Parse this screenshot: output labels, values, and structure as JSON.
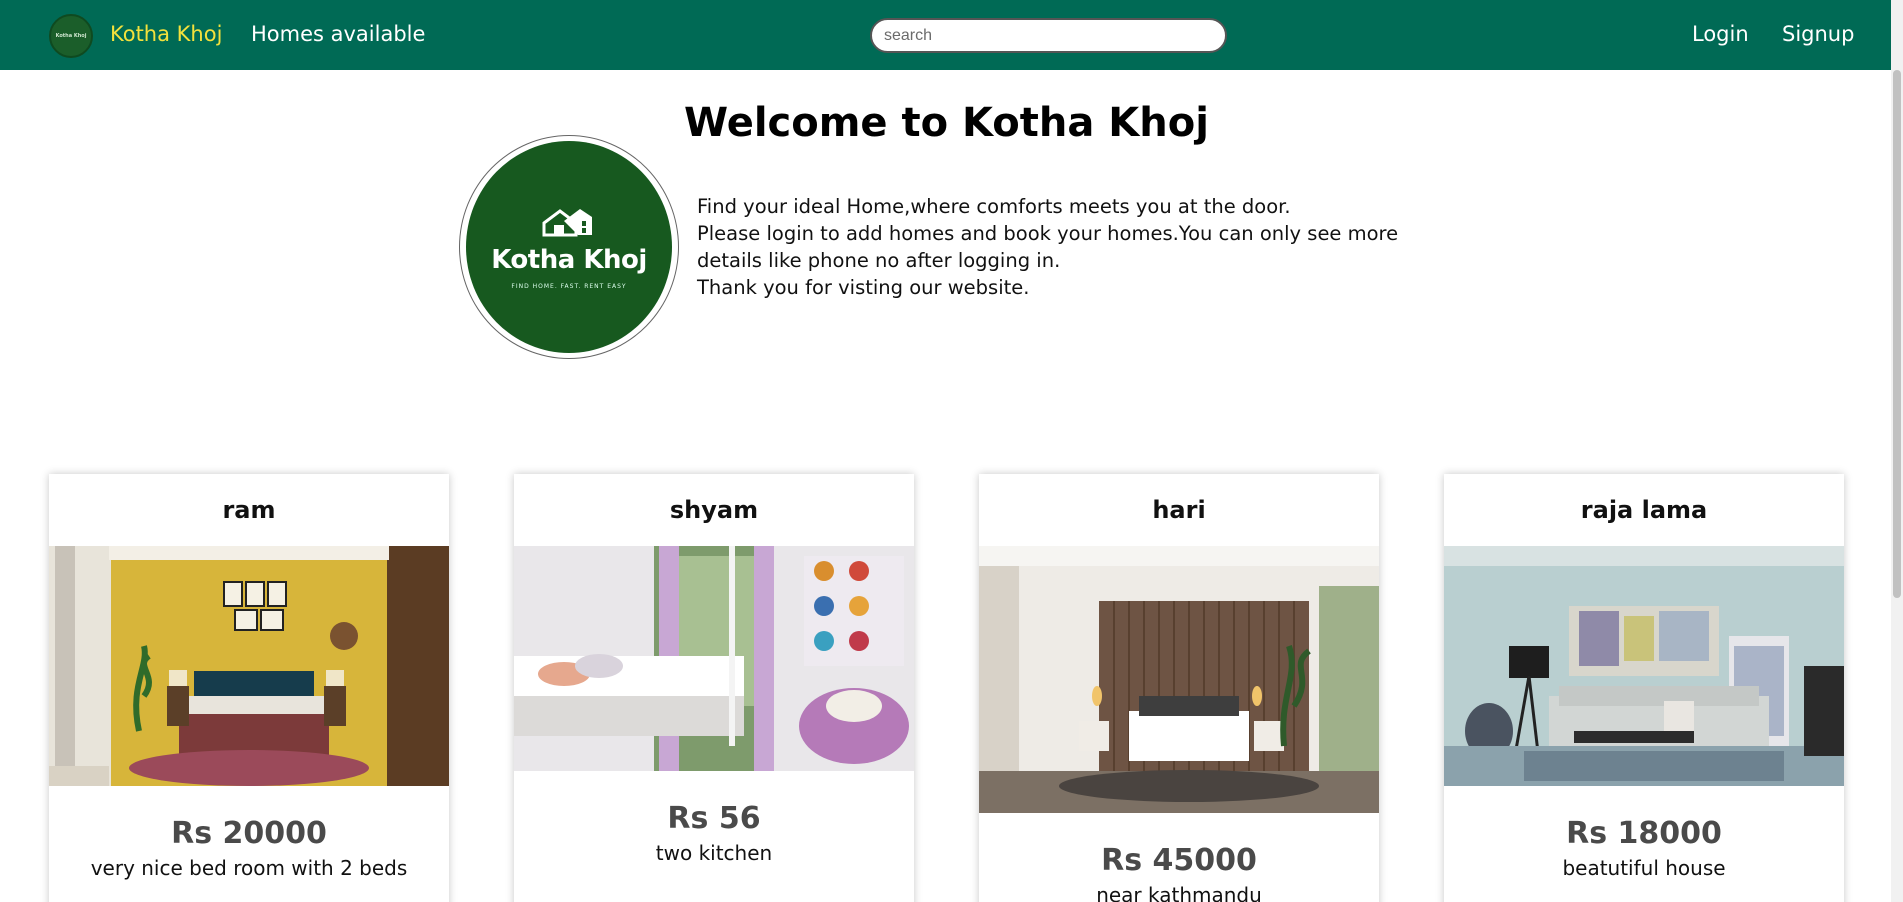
{
  "navbar": {
    "logo_text": "Kotha Khoj",
    "brand": "Kotha Khoj",
    "homes_link": "Homes available",
    "search_placeholder": "search",
    "login": "Login",
    "signup": "Signup"
  },
  "hero": {
    "title": "Welcome to Kotha Khoj",
    "logo_name": "Kotha Khoj",
    "logo_tagline": "FIND HOME. FAST. RENT EASY",
    "lines": [
      "Find your ideal Home,where comforts meets you at the door.",
      "Please login to add homes and book your homes.You can only see more details like phone no after logging in.",
      "Thank you for visting our website."
    ]
  },
  "listings": [
    {
      "owner": "ram",
      "price": "Rs 20000",
      "description": "very nice bed room with 2 beds"
    },
    {
      "owner": "shyam",
      "price": "Rs 56",
      "description": "two kitchen"
    },
    {
      "owner": "hari",
      "price": "Rs 45000",
      "description": "near kathmandu"
    },
    {
      "owner": "raja lama",
      "price": "Rs 18000",
      "description": "beatutiful house"
    }
  ],
  "colors": {
    "navbar_bg": "#006a55",
    "brand_text": "#f3e13c",
    "logo_green": "#17591f"
  }
}
